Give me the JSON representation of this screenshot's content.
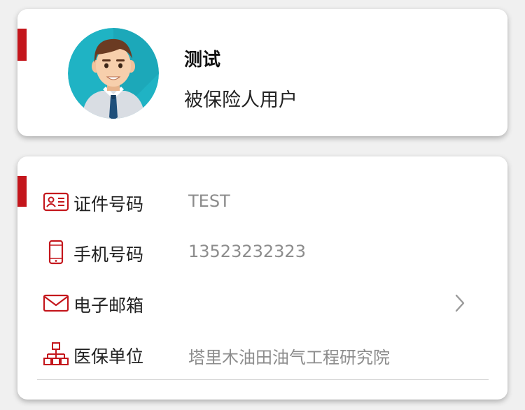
{
  "profile": {
    "name": "测试",
    "role": "被保险人用户"
  },
  "info": {
    "rows": [
      {
        "label": "证件号码",
        "value": "TEST",
        "icon": "id-card-icon"
      },
      {
        "label": "手机号码",
        "value": "13523232323",
        "icon": "mobile-phone-icon"
      },
      {
        "label": "电子邮箱",
        "value": "",
        "icon": "envelope-icon",
        "has_chevron": true
      },
      {
        "label": "医保单位",
        "value": "塔里木油田油气工程研究院",
        "icon": "org-chart-icon"
      }
    ]
  },
  "colors": {
    "accent": "#c4161c",
    "icon": "#c4161c",
    "label": "#222222",
    "value": "#8c8c8c",
    "avatar_bg": "#1fb3c4",
    "background": "#f0f0f0"
  }
}
